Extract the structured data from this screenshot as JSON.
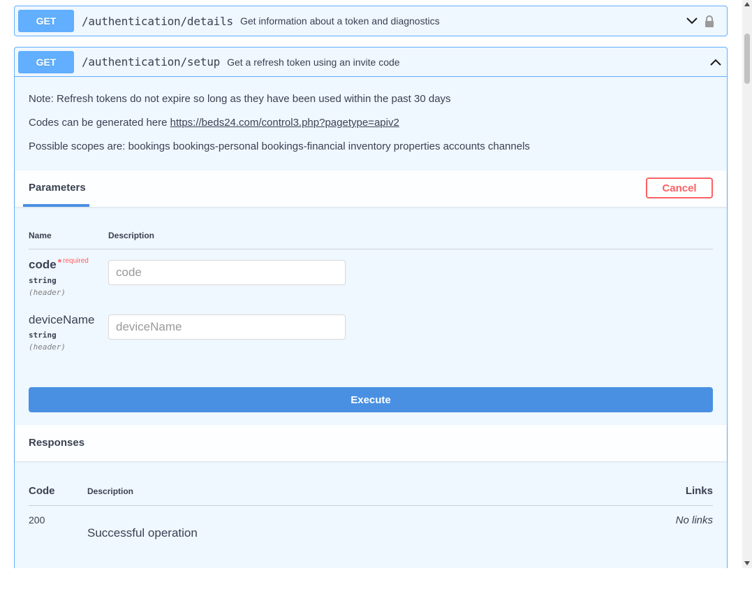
{
  "operations": [
    {
      "method": "GET",
      "path": "/authentication/details",
      "summary": "Get information about a token and diagnostics",
      "expanded": false
    },
    {
      "method": "GET",
      "path": "/authentication/setup",
      "summary": "Get a refresh token using an invite code",
      "expanded": true,
      "description": {
        "note": "Note: Refresh tokens do not expire so long as they have been used within the past 30 days",
        "codes_prefix": "Codes can be generated here ",
        "codes_link": "https://beds24.com/control3.php?pagetype=apiv2",
        "scopes": "Possible scopes are: bookings bookings-personal bookings-financial inventory properties accounts channels"
      },
      "parameters_tab": "Parameters",
      "cancel_label": "Cancel",
      "param_headers": {
        "name": "Name",
        "description": "Description"
      },
      "parameters": [
        {
          "name": "code",
          "required_star": "*",
          "required_label": "required",
          "type": "string",
          "in": "(header)",
          "placeholder": "code",
          "value": ""
        },
        {
          "name": "deviceName",
          "type": "string",
          "in": "(header)",
          "placeholder": "deviceName",
          "value": ""
        }
      ],
      "execute_label": "Execute",
      "responses_title": "Responses",
      "response_headers": {
        "code": "Code",
        "description": "Description",
        "links": "Links"
      },
      "responses": [
        {
          "code": "200",
          "description": "Successful operation",
          "links": "No links"
        }
      ]
    }
  ],
  "colors": {
    "get": "#61affe",
    "execute": "#4990e2",
    "cancel": "#ff6060"
  },
  "icons": {
    "collapse": "chevron-down-icon",
    "lock": "lock-icon",
    "expand": "chevron-up-icon"
  }
}
